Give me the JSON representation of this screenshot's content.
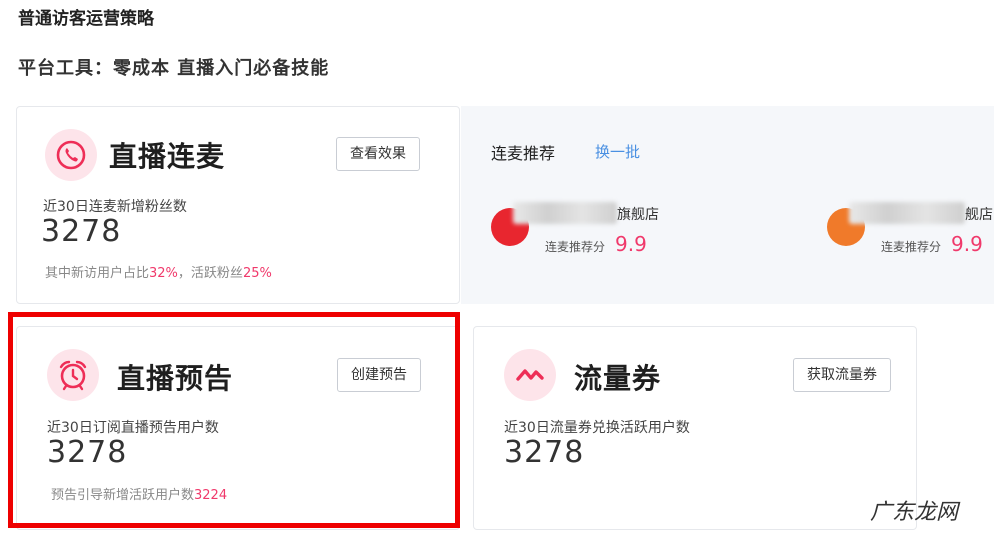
{
  "page": {
    "heading": "普通访客运营策略",
    "subheading": "平台工具：零成本 直播入门必备技能"
  },
  "live_link": {
    "title": "直播连麦",
    "button": "查看效果",
    "metric_label": "近30日连麦新增粉丝数",
    "metric_value": "3278",
    "note_prefix": "其中新访用户占比",
    "note_pct1": "32%",
    "note_mid": "，活跃粉丝",
    "note_pct2": "25%"
  },
  "recommend": {
    "title": "连麦推荐",
    "refresh": "换一批",
    "items": [
      {
        "name_suffix": "旗舰店",
        "score_label": "连麦推荐分",
        "score": "9.9",
        "avatar_color": "#e8262f"
      },
      {
        "name_suffix": "舰店",
        "score_label": "连麦推荐分",
        "score": "9.9",
        "avatar_color": "#f07a2a"
      }
    ]
  },
  "preview": {
    "title": "直播预告",
    "button": "创建预告",
    "metric_label": "近30日订阅直播预告用户数",
    "metric_value": "3278",
    "note_prefix": "预告引导新增活跃用户数",
    "note_value": "3224"
  },
  "coupon": {
    "title": "流量券",
    "button": "获取流量券",
    "metric_label": "近30日流量券兑换活跃用户数",
    "metric_value": "3278"
  },
  "watermark": "广东龙网",
  "colors": {
    "accent": "#f0396b",
    "icon_bg": "#fde4ea",
    "link": "#4a90e2",
    "highlight_box": "#ee0000"
  },
  "icons": {
    "live_link": "phone-icon",
    "preview": "alarm-clock-icon",
    "coupon": "trend-wave-icon"
  }
}
